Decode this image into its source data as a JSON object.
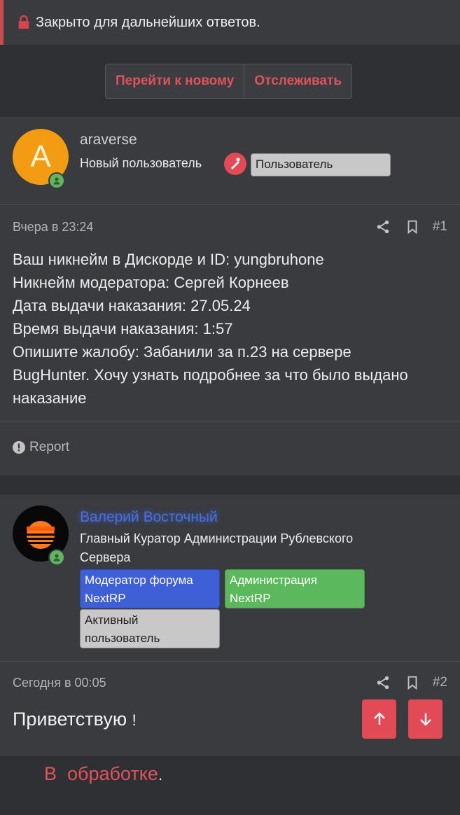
{
  "notice": {
    "text": "Закрыто для дальнейших ответов."
  },
  "toolbar": {
    "go_new": "Перейти к новому",
    "watch": "Отслеживать"
  },
  "posts": [
    {
      "username": "araverse",
      "avatar_letter": "A",
      "user_title": "Новый пользователь",
      "badges": [
        "Пользователь"
      ],
      "date": "Вчера в 23:24",
      "number": "#1",
      "lines": [
        "Ваш никнейм в Дискорде и ID: yungbruhone",
        "Никнейм модератора: Сергей Корнеев",
        "Дата выдачи наказания: 27.05.24",
        "Время выдачи наказания: 1:57",
        "Опишите жалобу: Забанили за п.23 на сервере",
        "BugHunter. Хочу узнать подробнее за что было выдано",
        "наказание"
      ],
      "report": "Report"
    },
    {
      "username": "Валерий Восточный",
      "user_title_1": "Главный Куратор Администрации Рублевского",
      "user_title_2": "Сервера",
      "badges": [
        "Модератор форума NextRP",
        "Администрация NextRP",
        "Активный пользователь"
      ],
      "badges_wrapped": [
        [
          "Модератор форума",
          "NextRP"
        ],
        [
          "Администрация",
          "NextRP"
        ],
        [
          "Активный",
          "пользователь"
        ]
      ],
      "date": "Сегодня в 00:05",
      "number": "#2",
      "line1": "Приветствую",
      "line1_end": "!",
      "line2": "В  обработке",
      "line2_end": "."
    }
  ],
  "colors": {
    "accent": "#e24a55",
    "online": "#63b363",
    "badge_blue": "#3f5fd6",
    "badge_green": "#5cb85c",
    "badge_gray": "#c8c8c8",
    "username_blue": "#4a6fd8"
  },
  "icons": [
    "lock-icon",
    "share-icon",
    "bookmark-icon",
    "user-online-icon",
    "report-icon",
    "arrow-up-icon",
    "arrow-down-icon",
    "new-user-icon"
  ]
}
